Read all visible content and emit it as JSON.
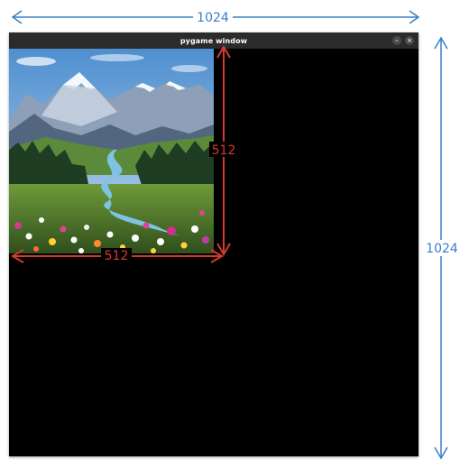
{
  "window": {
    "title": "pygame window",
    "minimize_glyph": "–",
    "close_glyph": "×"
  },
  "annotations": {
    "window_width": "1024",
    "window_height": "1024",
    "image_width": "512",
    "image_height": "512"
  },
  "colors": {
    "annotation_window": "#3a7ec6",
    "annotation_image": "#d63a2e",
    "canvas": "#000000",
    "titlebar": "#2b2b2b"
  },
  "icons": {
    "minimize": "minimize-icon",
    "close": "close-icon"
  }
}
